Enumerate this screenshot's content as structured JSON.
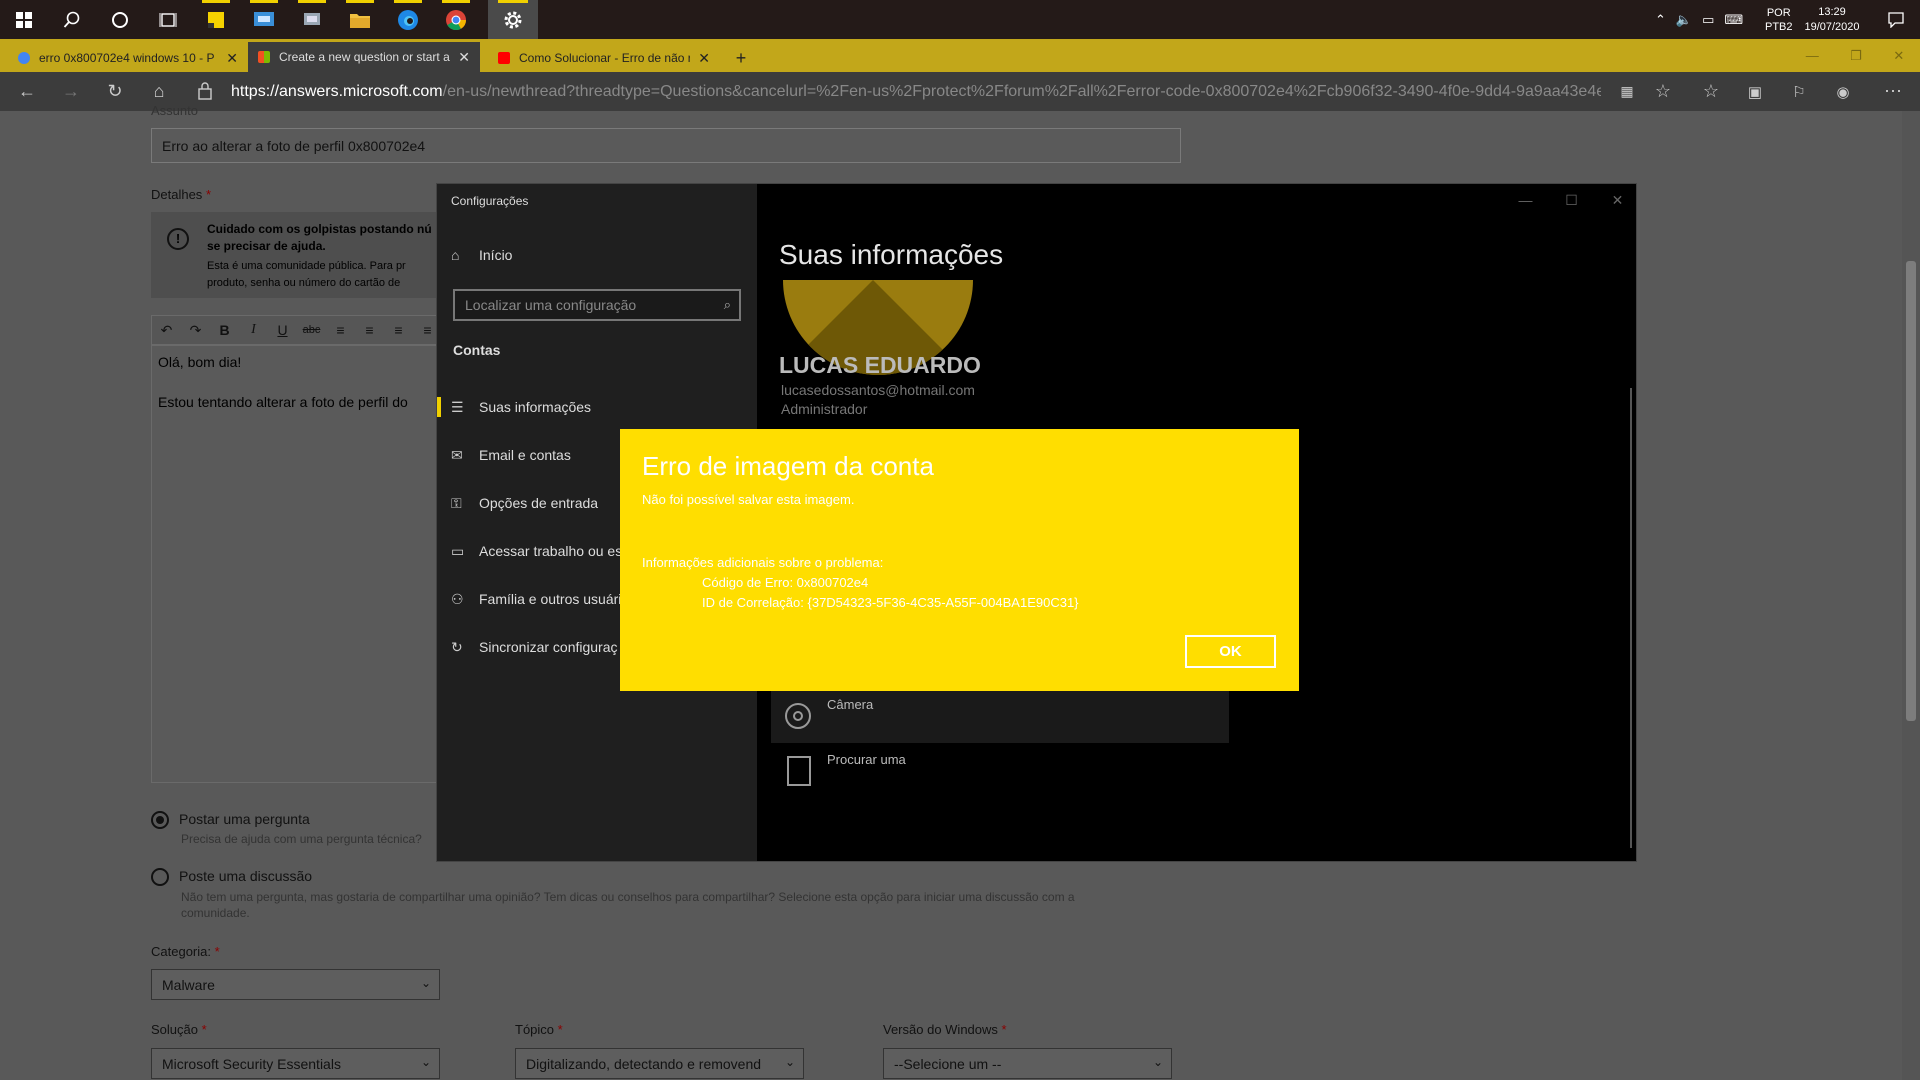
{
  "taskbar": {
    "tray": {
      "lang_top": "POR",
      "lang_bottom": "PTB2",
      "time": "13:29",
      "date": "19/07/2020"
    }
  },
  "browser": {
    "tabs": [
      {
        "label": "erro 0x800702e4 windows 10 - P",
        "color": "#4285f4"
      },
      {
        "label": "Create a new question or start a",
        "color": "#f25022"
      },
      {
        "label": "Como Solucionar - Erro de não r",
        "color": "#ff0000"
      }
    ],
    "url_host": "https://answers.microsoft.com",
    "url_path": "/en-us/newthread?threadtype=Questions&cancelurl=%2Fen-us%2Fprotect%2Fforum%2Fall%2Ferror-code-0x800702e4%2Fcb906f32-3490-4f0e-9dd4-9a9aa43e4e..."
  },
  "form": {
    "subject_label": "Assunto",
    "subject_value": "Erro ao alterar a foto de perfil 0x800702e4",
    "details_label": "Detalhes",
    "required_mark": "*",
    "warning_title": "Cuidado com os golpistas postando nú",
    "warning_title2": "se precisar de ajuda.",
    "warning_text1": "Esta é uma comunidade pública. Para pr",
    "warning_text2": "produto, senha ou número do cartão de",
    "editor_line1": "Olá, bom dia!",
    "editor_line2": "Estou tentando alterar a foto de perfil do",
    "post_question_label": "Postar uma pergunta",
    "post_question_hint": "Precisa de ajuda com uma pergunta técnica?",
    "post_discussion_label": "Poste uma discussão",
    "post_discussion_hint": "Não tem uma pergunta, mas gostaria de compartilhar uma opinião? Tem dicas ou conselhos para compartilhar? Selecione esta opção para iniciar uma discussão com a comunidade.",
    "category_label": "Categoria:",
    "category_value": "Malware",
    "solution_label": "Solução",
    "solution_value": "Microsoft Security Essentials",
    "topic_label": "Tópico",
    "topic_value": "Digitalizando, detectando e removend",
    "windows_label": "Versão do Windows",
    "windows_value": "--Selecione um --"
  },
  "settings": {
    "title": "Configurações",
    "home": "Início",
    "search_placeholder": "Localizar uma configuração",
    "section": "Contas",
    "nav": [
      {
        "label": "Suas informações",
        "icon": "person-card-icon"
      },
      {
        "label": "Email e contas",
        "icon": "mail-icon"
      },
      {
        "label": "Opções de entrada",
        "icon": "key-icon"
      },
      {
        "label": "Acessar trabalho ou es",
        "icon": "briefcase-icon"
      },
      {
        "label": "Família e outros usuári",
        "icon": "people-icon"
      },
      {
        "label": "Sincronizar configuraç",
        "icon": "sync-icon"
      }
    ],
    "heading": "Suas informações",
    "user_name": "LUCAS EDUARDO",
    "user_email": "lucasedossantos@hotmail.com",
    "user_role": "Administrador",
    "camera_label": "Câmera",
    "browse_label": "Procurar uma"
  },
  "dialog": {
    "title": "Erro de imagem da conta",
    "subtitle": "Não foi possível salvar esta imagem.",
    "info_header": "Informações adicionais sobre o problema:",
    "error_code": "Código de Erro: 0x800702e4",
    "correlation_id": "ID de Correlação: {37D54323-5F36-4C35-A55F-004BA1E90C31}",
    "ok_label": "OK",
    "bg_color": "#ffde00"
  }
}
